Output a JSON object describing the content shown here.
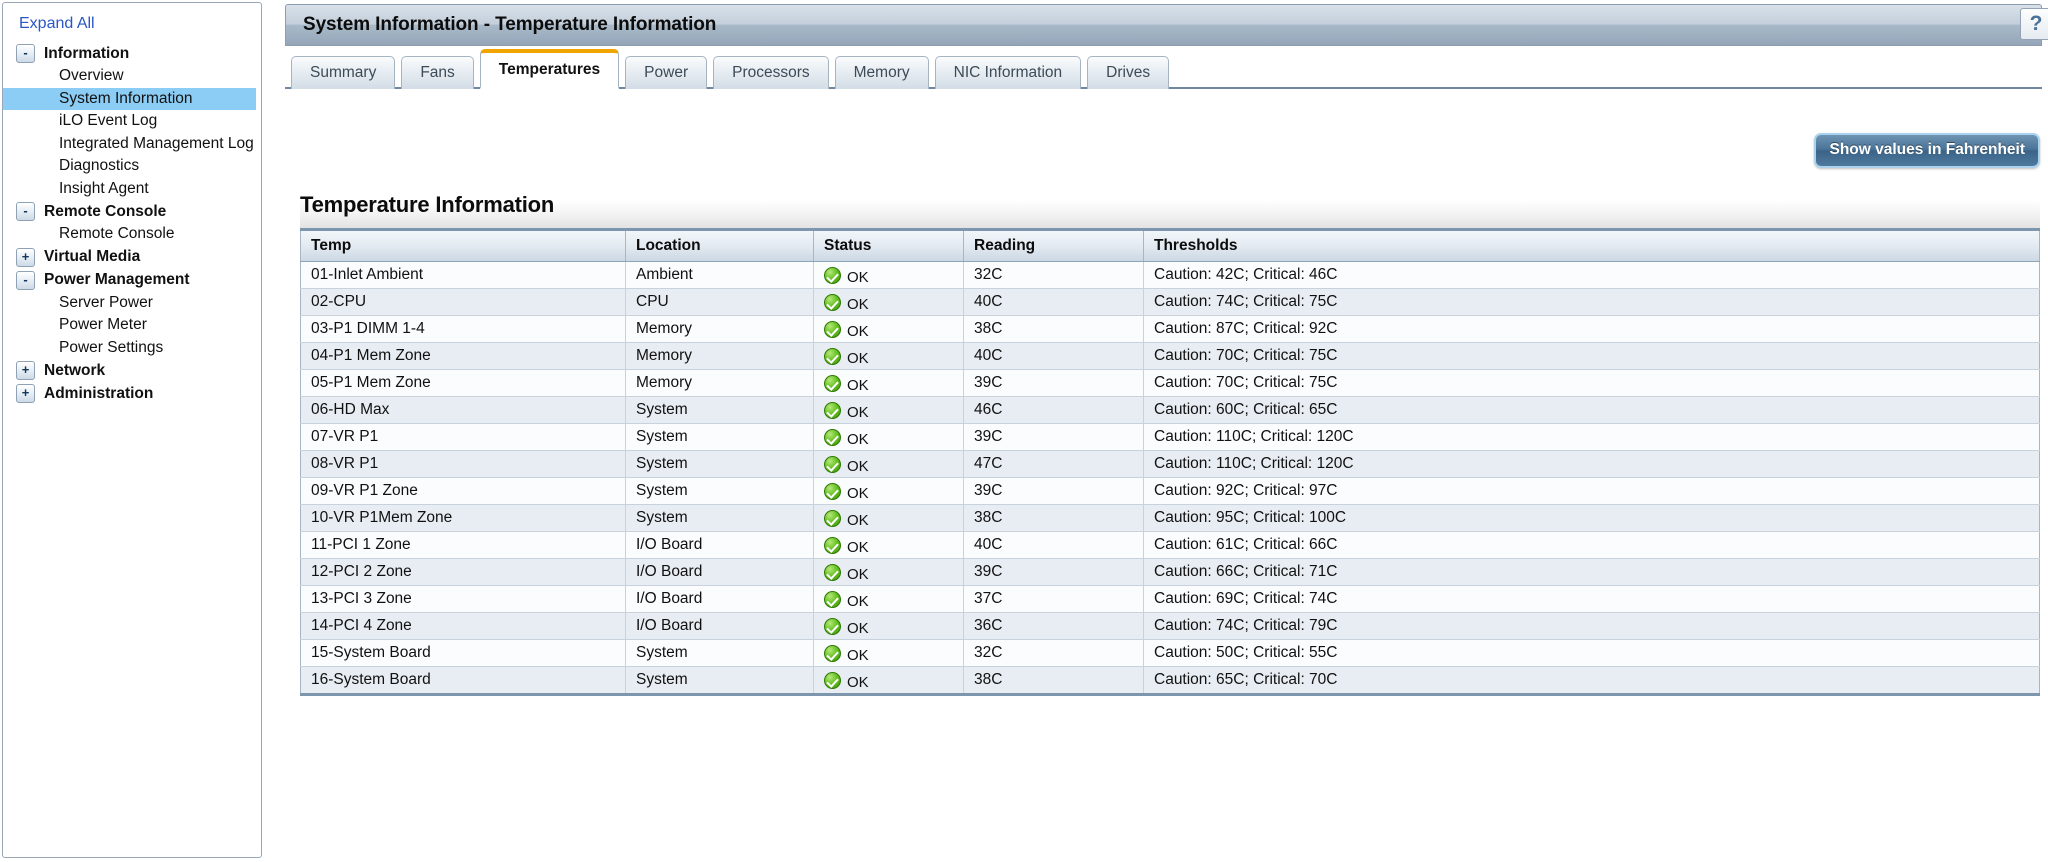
{
  "sidebar": {
    "expand_all_label": "Expand All",
    "groups": [
      {
        "label": "Information",
        "toggle": "-",
        "children": [
          {
            "label": "Overview",
            "selected": false
          },
          {
            "label": "System Information",
            "selected": true
          },
          {
            "label": "iLO Event Log",
            "selected": false
          },
          {
            "label": "Integrated Management Log",
            "selected": false
          },
          {
            "label": "Diagnostics",
            "selected": false
          },
          {
            "label": "Insight Agent",
            "selected": false
          }
        ]
      },
      {
        "label": "Remote Console",
        "toggle": "-",
        "children": [
          {
            "label": "Remote Console",
            "selected": false
          }
        ]
      },
      {
        "label": "Virtual Media",
        "toggle": "+",
        "children": []
      },
      {
        "label": "Power Management",
        "toggle": "-",
        "children": [
          {
            "label": "Server Power",
            "selected": false
          },
          {
            "label": "Power Meter",
            "selected": false
          },
          {
            "label": "Power Settings",
            "selected": false
          }
        ]
      },
      {
        "label": "Network",
        "toggle": "+",
        "children": []
      },
      {
        "label": "Administration",
        "toggle": "+",
        "children": []
      }
    ]
  },
  "header": {
    "title": "System Information - Temperature Information",
    "help_icon": "question-mark-icon",
    "help_label": "?"
  },
  "tabs": [
    {
      "label": "Summary",
      "active": false
    },
    {
      "label": "Fans",
      "active": false
    },
    {
      "label": "Temperatures",
      "active": true
    },
    {
      "label": "Power",
      "active": false
    },
    {
      "label": "Processors",
      "active": false
    },
    {
      "label": "Memory",
      "active": false
    },
    {
      "label": "NIC Information",
      "active": false
    },
    {
      "label": "Drives",
      "active": false
    }
  ],
  "toolbar": {
    "fahrenheit_label": "Show values in Fahrenheit"
  },
  "section": {
    "heading": "Temperature Information"
  },
  "table": {
    "columns": [
      "Temp",
      "Location",
      "Status",
      "Reading",
      "Thresholds"
    ],
    "rows": [
      {
        "temp": "01-Inlet Ambient",
        "location": "Ambient",
        "status": "OK",
        "reading": "32C",
        "thresholds": "Caution: 42C; Critical: 46C"
      },
      {
        "temp": "02-CPU",
        "location": "CPU",
        "status": "OK",
        "reading": "40C",
        "thresholds": "Caution: 74C; Critical: 75C"
      },
      {
        "temp": "03-P1 DIMM 1-4",
        "location": "Memory",
        "status": "OK",
        "reading": "38C",
        "thresholds": "Caution: 87C; Critical: 92C"
      },
      {
        "temp": "04-P1 Mem Zone",
        "location": "Memory",
        "status": "OK",
        "reading": "40C",
        "thresholds": "Caution: 70C; Critical: 75C"
      },
      {
        "temp": "05-P1 Mem Zone",
        "location": "Memory",
        "status": "OK",
        "reading": "39C",
        "thresholds": "Caution: 70C; Critical: 75C"
      },
      {
        "temp": "06-HD Max",
        "location": "System",
        "status": "OK",
        "reading": "46C",
        "thresholds": "Caution: 60C; Critical: 65C"
      },
      {
        "temp": "07-VR P1",
        "location": "System",
        "status": "OK",
        "reading": "39C",
        "thresholds": "Caution: 110C; Critical: 120C"
      },
      {
        "temp": "08-VR P1",
        "location": "System",
        "status": "OK",
        "reading": "47C",
        "thresholds": "Caution: 110C; Critical: 120C"
      },
      {
        "temp": "09-VR P1 Zone",
        "location": "System",
        "status": "OK",
        "reading": "39C",
        "thresholds": "Caution: 92C; Critical: 97C"
      },
      {
        "temp": "10-VR P1Mem Zone",
        "location": "System",
        "status": "OK",
        "reading": "38C",
        "thresholds": "Caution: 95C; Critical: 100C"
      },
      {
        "temp": "11-PCI 1 Zone",
        "location": "I/O Board",
        "status": "OK",
        "reading": "40C",
        "thresholds": "Caution: 61C; Critical: 66C"
      },
      {
        "temp": "12-PCI 2 Zone",
        "location": "I/O Board",
        "status": "OK",
        "reading": "39C",
        "thresholds": "Caution: 66C; Critical: 71C"
      },
      {
        "temp": "13-PCI 3 Zone",
        "location": "I/O Board",
        "status": "OK",
        "reading": "37C",
        "thresholds": "Caution: 69C; Critical: 74C"
      },
      {
        "temp": "14-PCI 4 Zone",
        "location": "I/O Board",
        "status": "OK",
        "reading": "36C",
        "thresholds": "Caution: 74C; Critical: 79C"
      },
      {
        "temp": "15-System Board",
        "location": "System",
        "status": "OK",
        "reading": "32C",
        "thresholds": "Caution: 50C; Critical: 55C"
      },
      {
        "temp": "16-System Board",
        "location": "System",
        "status": "OK",
        "reading": "38C",
        "thresholds": "Caution: 65C; Critical: 70C"
      }
    ]
  },
  "colors": {
    "accent": "#f0a500",
    "selection": "#8ccdf5",
    "link": "#2a56c6",
    "status_ok": "#64c021"
  }
}
